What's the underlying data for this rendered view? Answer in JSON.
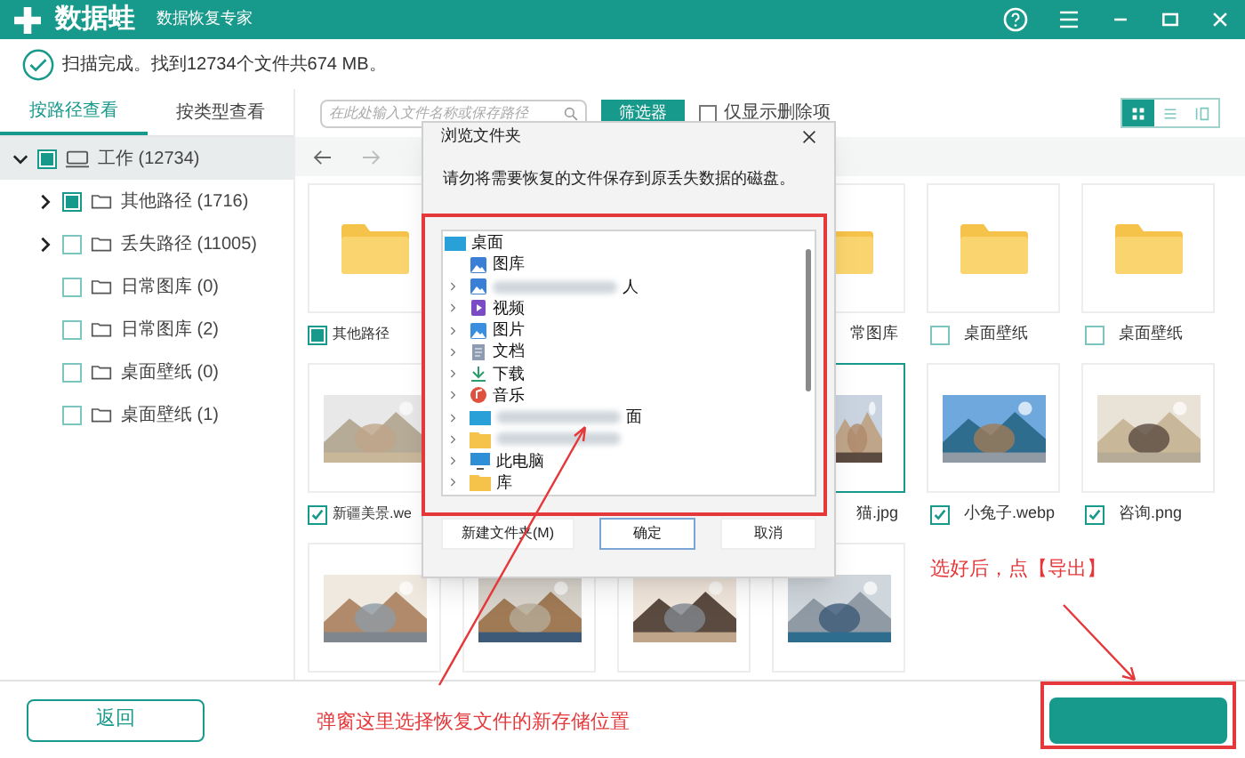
{
  "app": {
    "name": "数据蛙",
    "subtitle": "数据恢复专家"
  },
  "status": "扫描完成。找到12734个文件共674 MB。",
  "view_tabs": [
    {
      "label": "按路径查看",
      "selected": true
    },
    {
      "label": "按类型查看",
      "selected": false
    }
  ],
  "search": {
    "placeholder": "在此处输入文件名称或保存路径"
  },
  "filter_button": "筛选器",
  "deleted_only": {
    "label": "仅显示删除项",
    "checked": false
  },
  "view_modes": [
    {
      "kind": "grid",
      "selected": true
    },
    {
      "kind": "list",
      "selected": false
    },
    {
      "kind": "detail",
      "selected": false
    }
  ],
  "tree": [
    {
      "label": "工作 (12734)",
      "kind": "drive",
      "checked": false,
      "partial": true,
      "selected": true,
      "expanded": true,
      "children": [
        {
          "label": "其他路径 (1716)",
          "kind": "folder",
          "checked": false,
          "partial": true,
          "selected": false,
          "expanded": false
        },
        {
          "label": "丢失路径 (11005)",
          "kind": "folder",
          "checked": false,
          "partial": false,
          "selected": false,
          "expanded": false
        },
        {
          "label": "日常图库 (0)",
          "kind": "folder",
          "checked": false,
          "partial": false,
          "selected": false
        },
        {
          "label": "日常图库 (2)",
          "kind": "folder",
          "checked": false,
          "partial": false,
          "selected": false
        },
        {
          "label": "桌面壁纸 (0)",
          "kind": "folder",
          "checked": false,
          "partial": false,
          "selected": false
        },
        {
          "label": "桌面壁纸 (1)",
          "kind": "folder",
          "checked": false,
          "partial": false,
          "selected": false
        }
      ]
    }
  ],
  "grid_rows": [
    [
      {
        "kind": "folder",
        "label": "其他路径",
        "checked": false,
        "partial": true,
        "selected": false
      },
      null,
      null,
      {
        "kind": "folder",
        "label": "常图库",
        "selected": false
      },
      {
        "kind": "folder",
        "label": "桌面壁纸",
        "checked": false,
        "selected": false
      },
      {
        "kind": "folder",
        "label": "桌面壁纸",
        "checked": false,
        "selected": false
      }
    ],
    [
      {
        "kind": "picture",
        "label": "新疆美景.we",
        "checked": true,
        "selected": false
      },
      null,
      null,
      {
        "kind": "picture",
        "label": "猫.jpg",
        "selected": true
      },
      {
        "kind": "picture",
        "label": "小兔子.webp",
        "checked": true,
        "selected": false
      },
      {
        "kind": "picture",
        "label": "咨询.png",
        "checked": true,
        "selected": false
      }
    ],
    [
      {
        "kind": "picture",
        "selected": false
      },
      {
        "kind": "picture",
        "selected": false
      },
      {
        "kind": "picture",
        "selected": false
      },
      {
        "kind": "picture",
        "selected": false
      }
    ]
  ],
  "back_button": "返回",
  "dialog": {
    "title": "浏览文件夹",
    "message": "请勿将需要恢复的文件保存到原丢失数据的磁盘。",
    "folders": [
      {
        "label": "桌面",
        "kind": "desktop",
        "expandable": false,
        "blurred": false
      },
      {
        "label": "图库",
        "kind": "gallery",
        "expandable": false,
        "blurred": false
      },
      {
        "label": "人",
        "kind": "user",
        "expandable": true,
        "blurred": true
      },
      {
        "label": "视频",
        "kind": "video",
        "expandable": true,
        "blurred": false
      },
      {
        "label": "图片",
        "kind": "pictures",
        "expandable": true,
        "blurred": false
      },
      {
        "label": "文档",
        "kind": "documents",
        "expandable": true,
        "blurred": false
      },
      {
        "label": "下载",
        "kind": "downloads",
        "expandable": true,
        "blurred": false
      },
      {
        "label": "音乐",
        "kind": "music",
        "expandable": true,
        "blurred": false
      },
      {
        "label": "面",
        "kind": "desktop",
        "expandable": true,
        "blurred": true
      },
      {
        "kind": "folder",
        "expandable": true,
        "blurred": true
      },
      {
        "label": "此电脑",
        "kind": "pc",
        "expandable": true,
        "blurred": false
      },
      {
        "label": "库",
        "kind": "folder",
        "expandable": true,
        "blurred": false
      }
    ],
    "buttons": [
      {
        "label": "新建文件夹(M)",
        "focused": false
      },
      {
        "label": "确定",
        "focused": true
      },
      {
        "label": "取消",
        "focused": false
      }
    ]
  },
  "annotations": [
    {
      "kind": "note",
      "text": "选好后，点【导出】"
    },
    {
      "kind": "note",
      "text": "弹窗这里选择恢复文件的新存储位置"
    }
  ]
}
